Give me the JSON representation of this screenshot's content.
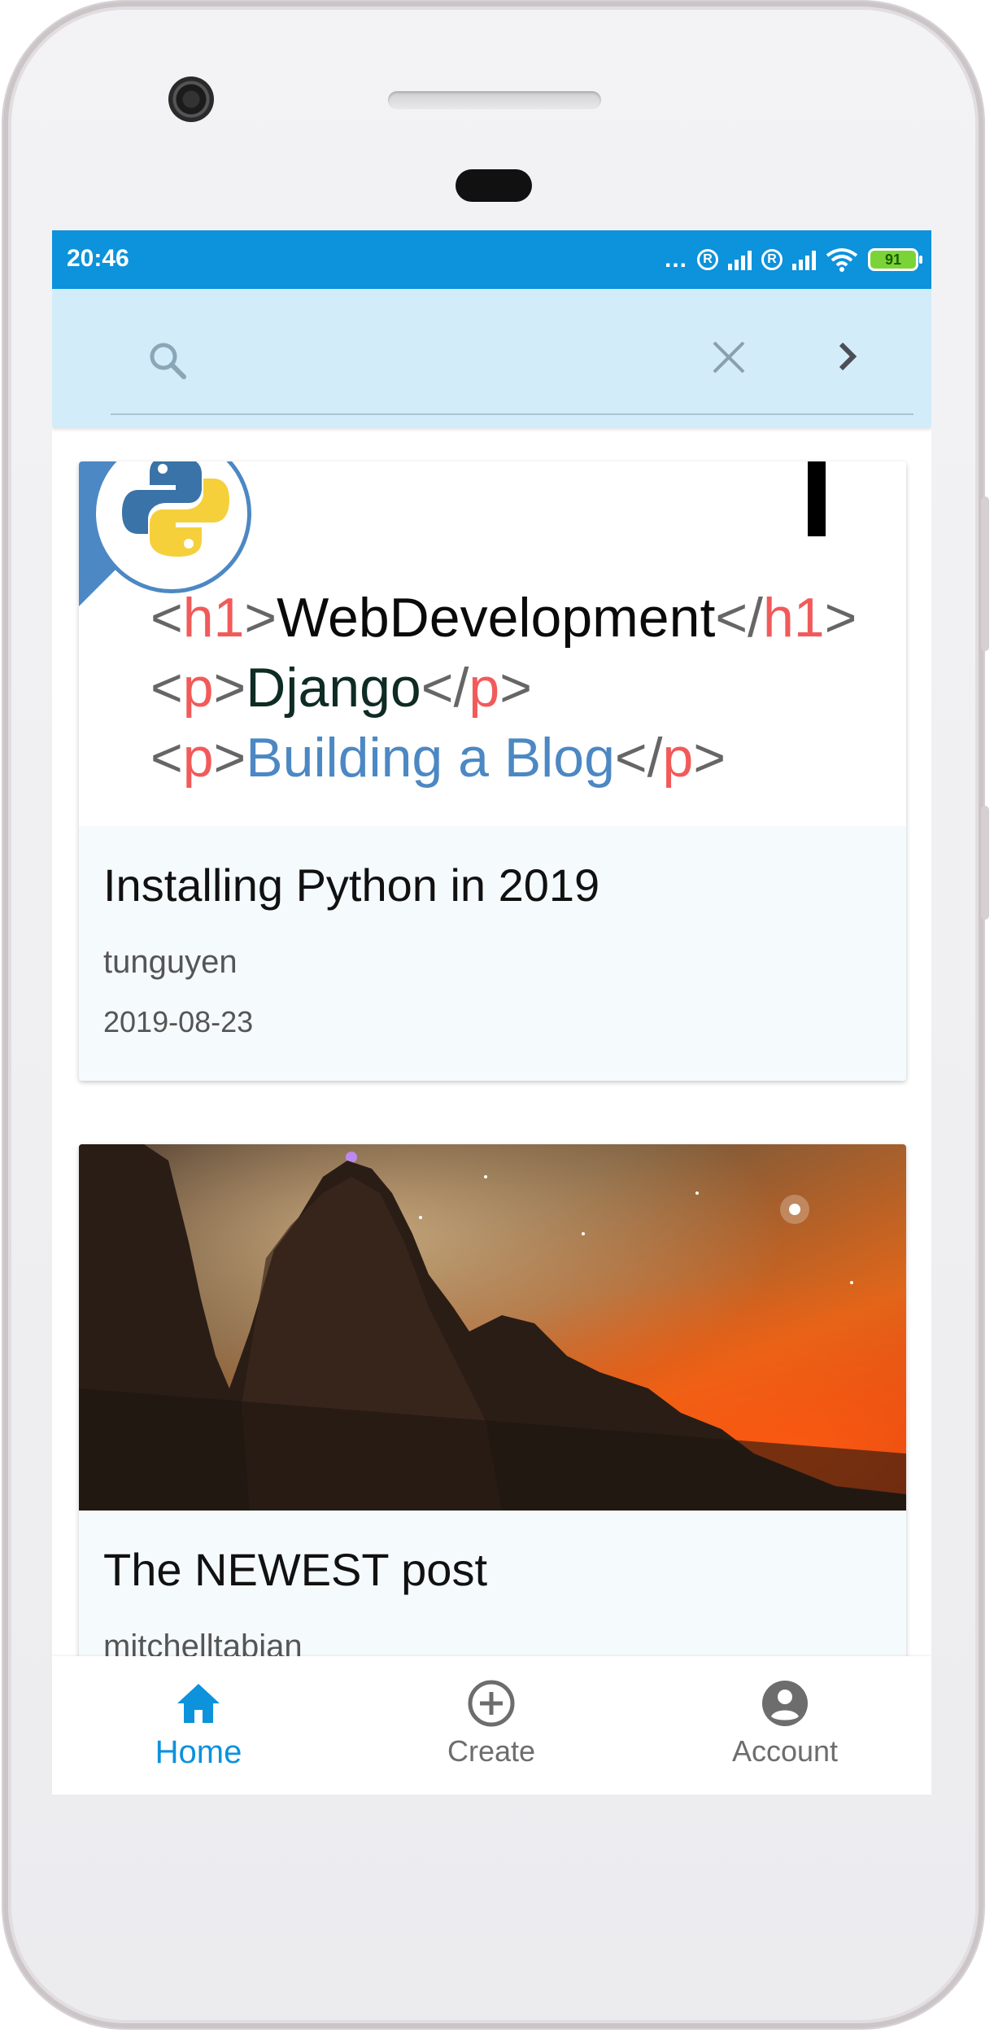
{
  "status_bar": {
    "time": "20:46",
    "battery": "91",
    "dots": "...",
    "sim_mark": "R"
  },
  "search": {
    "placeholder": "",
    "value": ""
  },
  "posts": [
    {
      "title": "Installing Python in 2019",
      "author": "tunguyen",
      "date": "2019-08-23",
      "thumbnail_code": {
        "line1": {
          "open_bracket": "<",
          "tag": "h1",
          "close_bracket": ">",
          "text": "WebDevelopment",
          "end_open": "</",
          "end_tag": "h1",
          "end_close": ">"
        },
        "line2": {
          "open_bracket": "<",
          "tag": "p",
          "close_bracket": ">",
          "text": "Django",
          "end_open": "</",
          "end_tag": "p",
          "end_close": ">"
        },
        "line3": {
          "open_bracket": "<",
          "tag": "p",
          "close_bracket": ">",
          "text": "Building a Blog",
          "end_open": "</",
          "end_tag": "p",
          "end_close": ">"
        }
      }
    },
    {
      "title": "The NEWEST post",
      "author": "mitchelltabian",
      "thumbnail": "night-sky-mountains"
    }
  ],
  "bottom_nav": [
    {
      "label": "Home",
      "icon": "home-icon",
      "active": true
    },
    {
      "label": "Create",
      "icon": "add-circle-icon",
      "active": false
    },
    {
      "label": "Account",
      "icon": "account-circle-icon",
      "active": false
    }
  ],
  "colors": {
    "status_bar": "#0d92dc",
    "search_bar": "#d3ecf9",
    "active_nav": "#0d92dc",
    "card_body": "#f5fafd"
  }
}
